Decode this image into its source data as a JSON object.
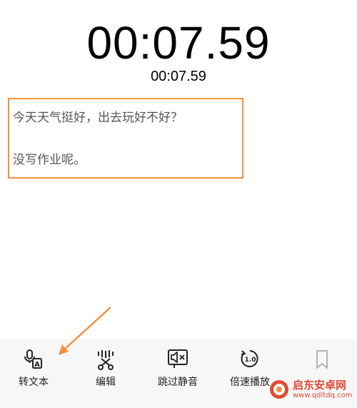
{
  "timer": {
    "main": "00:07.59",
    "sub": "00:07.59"
  },
  "transcript": {
    "line1": "今天天气挺好，出去玩好不好？",
    "line2": "没写作业呢。"
  },
  "toolbar": {
    "items": [
      {
        "label": "转文本",
        "icon": "speech-to-text-icon"
      },
      {
        "label": "编辑",
        "icon": "scissors-waveform-icon"
      },
      {
        "label": "跳过静音",
        "icon": "skip-silence-icon"
      },
      {
        "label": "倍速播放",
        "icon": "playback-speed-icon",
        "speed": "1.0"
      },
      {
        "label": "",
        "icon": "bookmark-icon"
      }
    ]
  },
  "watermark": {
    "title": "启东安卓网",
    "url": "www.qdltdq.com"
  },
  "colors": {
    "highlight": "#f2923f",
    "watermark": "#e24a33",
    "toolbar_bg": "#f7f7f7"
  }
}
